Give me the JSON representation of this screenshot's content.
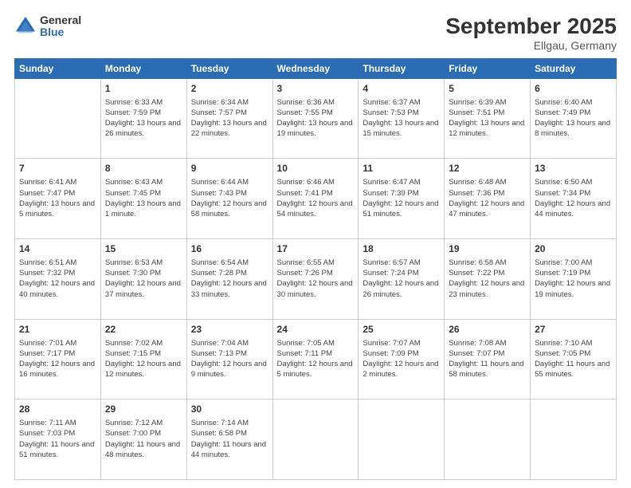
{
  "logo": {
    "general": "General",
    "blue": "Blue"
  },
  "title": "September 2025",
  "subtitle": "Ellgau, Germany",
  "days_header": [
    "Sunday",
    "Monday",
    "Tuesday",
    "Wednesday",
    "Thursday",
    "Friday",
    "Saturday"
  ],
  "weeks": [
    [
      {
        "num": "",
        "info": ""
      },
      {
        "num": "1",
        "info": "Sunrise: 6:33 AM\nSunset: 7:59 PM\nDaylight: 13 hours and 26 minutes."
      },
      {
        "num": "2",
        "info": "Sunrise: 6:34 AM\nSunset: 7:57 PM\nDaylight: 13 hours and 22 minutes."
      },
      {
        "num": "3",
        "info": "Sunrise: 6:36 AM\nSunset: 7:55 PM\nDaylight: 13 hours and 19 minutes."
      },
      {
        "num": "4",
        "info": "Sunrise: 6:37 AM\nSunset: 7:53 PM\nDaylight: 13 hours and 15 minutes."
      },
      {
        "num": "5",
        "info": "Sunrise: 6:39 AM\nSunset: 7:51 PM\nDaylight: 13 hours and 12 minutes."
      },
      {
        "num": "6",
        "info": "Sunrise: 6:40 AM\nSunset: 7:49 PM\nDaylight: 13 hours and 8 minutes."
      }
    ],
    [
      {
        "num": "7",
        "info": "Sunrise: 6:41 AM\nSunset: 7:47 PM\nDaylight: 13 hours and 5 minutes."
      },
      {
        "num": "8",
        "info": "Sunrise: 6:43 AM\nSunset: 7:45 PM\nDaylight: 13 hours and 1 minute."
      },
      {
        "num": "9",
        "info": "Sunrise: 6:44 AM\nSunset: 7:43 PM\nDaylight: 12 hours and 58 minutes."
      },
      {
        "num": "10",
        "info": "Sunrise: 6:46 AM\nSunset: 7:41 PM\nDaylight: 12 hours and 54 minutes."
      },
      {
        "num": "11",
        "info": "Sunrise: 6:47 AM\nSunset: 7:39 PM\nDaylight: 12 hours and 51 minutes."
      },
      {
        "num": "12",
        "info": "Sunrise: 6:48 AM\nSunset: 7:36 PM\nDaylight: 12 hours and 47 minutes."
      },
      {
        "num": "13",
        "info": "Sunrise: 6:50 AM\nSunset: 7:34 PM\nDaylight: 12 hours and 44 minutes."
      }
    ],
    [
      {
        "num": "14",
        "info": "Sunrise: 6:51 AM\nSunset: 7:32 PM\nDaylight: 12 hours and 40 minutes."
      },
      {
        "num": "15",
        "info": "Sunrise: 6:53 AM\nSunset: 7:30 PM\nDaylight: 12 hours and 37 minutes."
      },
      {
        "num": "16",
        "info": "Sunrise: 6:54 AM\nSunset: 7:28 PM\nDaylight: 12 hours and 33 minutes."
      },
      {
        "num": "17",
        "info": "Sunrise: 6:55 AM\nSunset: 7:26 PM\nDaylight: 12 hours and 30 minutes."
      },
      {
        "num": "18",
        "info": "Sunrise: 6:57 AM\nSunset: 7:24 PM\nDaylight: 12 hours and 26 minutes."
      },
      {
        "num": "19",
        "info": "Sunrise: 6:58 AM\nSunset: 7:22 PM\nDaylight: 12 hours and 23 minutes."
      },
      {
        "num": "20",
        "info": "Sunrise: 7:00 AM\nSunset: 7:19 PM\nDaylight: 12 hours and 19 minutes."
      }
    ],
    [
      {
        "num": "21",
        "info": "Sunrise: 7:01 AM\nSunset: 7:17 PM\nDaylight: 12 hours and 16 minutes."
      },
      {
        "num": "22",
        "info": "Sunrise: 7:02 AM\nSunset: 7:15 PM\nDaylight: 12 hours and 12 minutes."
      },
      {
        "num": "23",
        "info": "Sunrise: 7:04 AM\nSunset: 7:13 PM\nDaylight: 12 hours and 9 minutes."
      },
      {
        "num": "24",
        "info": "Sunrise: 7:05 AM\nSunset: 7:11 PM\nDaylight: 12 hours and 5 minutes."
      },
      {
        "num": "25",
        "info": "Sunrise: 7:07 AM\nSunset: 7:09 PM\nDaylight: 12 hours and 2 minutes."
      },
      {
        "num": "26",
        "info": "Sunrise: 7:08 AM\nSunset: 7:07 PM\nDaylight: 11 hours and 58 minutes."
      },
      {
        "num": "27",
        "info": "Sunrise: 7:10 AM\nSunset: 7:05 PM\nDaylight: 11 hours and 55 minutes."
      }
    ],
    [
      {
        "num": "28",
        "info": "Sunrise: 7:11 AM\nSunset: 7:03 PM\nDaylight: 11 hours and 51 minutes."
      },
      {
        "num": "29",
        "info": "Sunrise: 7:12 AM\nSunset: 7:00 PM\nDaylight: 11 hours and 48 minutes."
      },
      {
        "num": "30",
        "info": "Sunrise: 7:14 AM\nSunset: 6:58 PM\nDaylight: 11 hours and 44 minutes."
      },
      {
        "num": "",
        "info": ""
      },
      {
        "num": "",
        "info": ""
      },
      {
        "num": "",
        "info": ""
      },
      {
        "num": "",
        "info": ""
      }
    ]
  ]
}
